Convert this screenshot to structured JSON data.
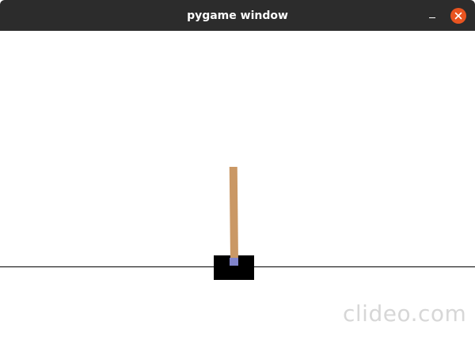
{
  "window": {
    "title": "pygame window",
    "controls": {
      "minimize_icon": "minimize-icon",
      "close_icon": "close-icon"
    }
  },
  "colors": {
    "titlebar": "#2c2c2c",
    "close_button": "#e95420",
    "background": "#ffffff",
    "cart": "#000000",
    "pole": "#ca9865",
    "axle": "#8184cb",
    "track": "#000000"
  },
  "watermark": {
    "text": "clideo.com"
  }
}
